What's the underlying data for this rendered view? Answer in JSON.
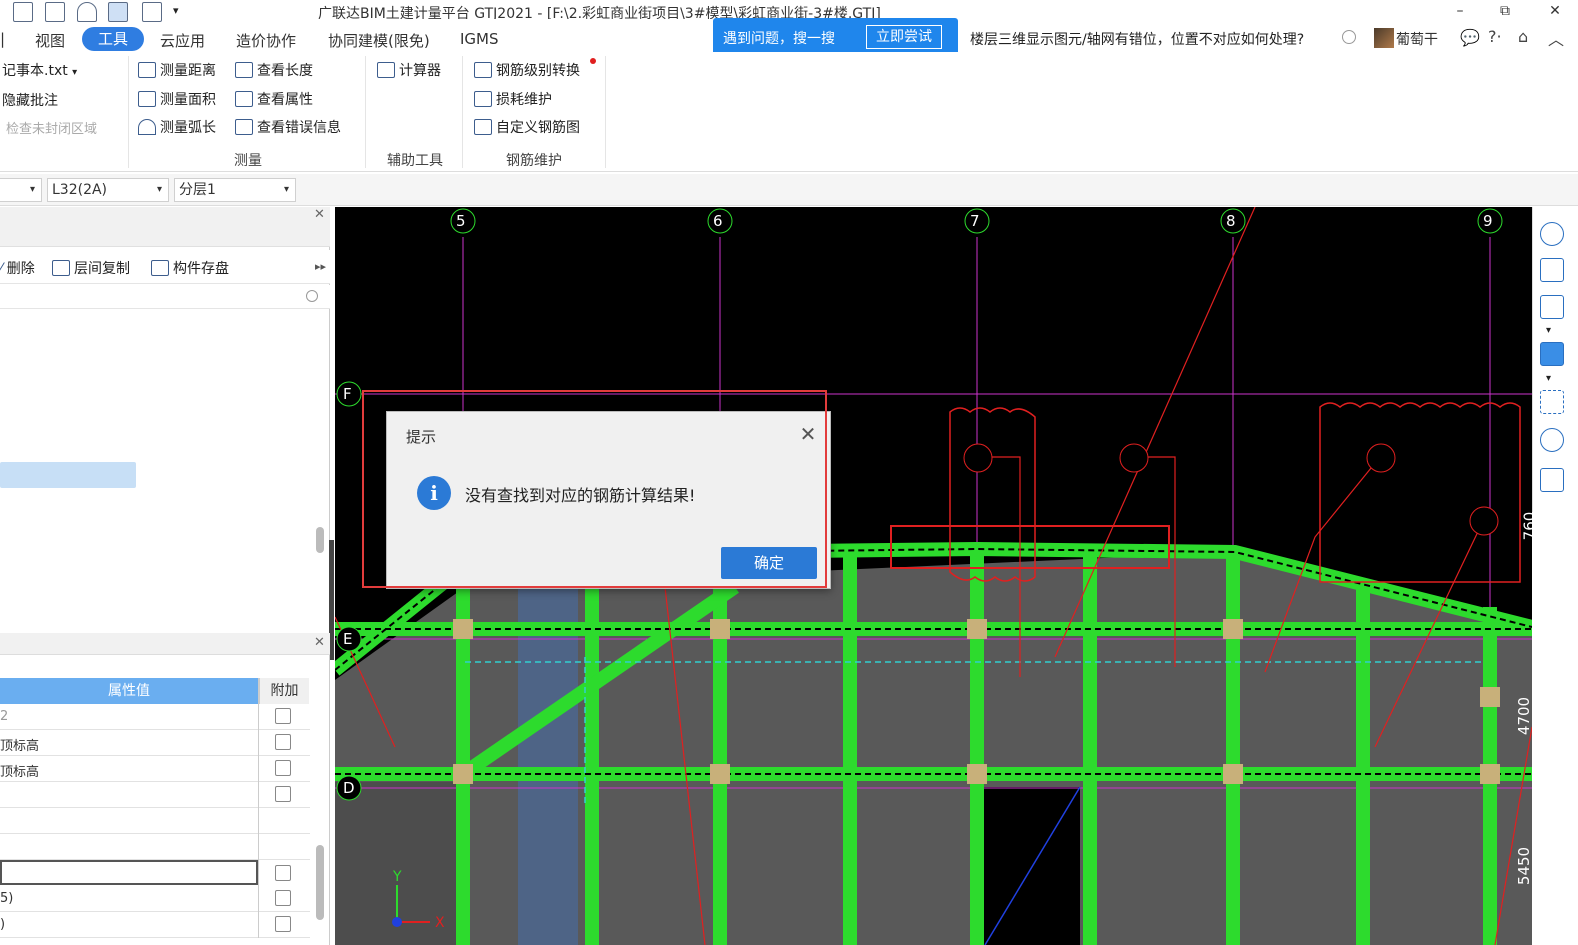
{
  "window": {
    "title": "广联达BIM土建计量平台 GTJ2021 - [F:\\2.彩虹商业街项目\\3#模型\\彩虹商业街-3#楼.GTJ]",
    "min": "–",
    "restore": "⧉",
    "close": "✕"
  },
  "menu": {
    "items": [
      "视图",
      "工具",
      "云应用",
      "造价协作",
      "协同建模(限免)",
      "IGMS"
    ],
    "active": "工具"
  },
  "banner": {
    "text": "遇到问题，搜一搜",
    "button": "立即尝试"
  },
  "search": {
    "question": "楼层三维显示图元/轴网有错位，位置不对应如何处理?"
  },
  "user": {
    "name": "葡萄干"
  },
  "ribbon": {
    "col1": [
      "记事本.txt",
      "隐藏批注",
      "检查未封闭区域"
    ],
    "measure": [
      "测量距离",
      "测量面积",
      "测量弧长"
    ],
    "view": [
      "查看长度",
      "查看属性",
      "查看错误信息"
    ],
    "aux": [
      "计算器"
    ],
    "rebar": [
      "钢筋级别转换",
      "损耗维护",
      "自定义钢筋图"
    ],
    "groups": [
      "测量",
      "辅助工具",
      "钢筋维护"
    ]
  },
  "combos": {
    "c2": "L32(2A)",
    "c3": "分层1"
  },
  "left_panel": {
    "toolbar": [
      "删除",
      "层间复制",
      "构件存盘"
    ]
  },
  "props": {
    "header_value": "属性值",
    "header_extra": "附加",
    "rows": [
      "2",
      "顶标高",
      "顶标高",
      "",
      "",
      "",
      "",
      "5)",
      ")"
    ]
  },
  "grid": {
    "columns": [
      "5",
      "6",
      "7",
      "8",
      "9"
    ],
    "rows": [
      "F",
      "E",
      "D"
    ],
    "dims": [
      "760",
      "4700",
      "5450"
    ]
  },
  "dialog": {
    "title": "提示",
    "message": "没有查找到对应的钢筋计算结果!",
    "ok": "确定",
    "close": "✕",
    "info_icon": "i"
  },
  "colors": {
    "accent": "#2b7ad6",
    "beam": "#2ddb2d",
    "axis": "#cc33cc",
    "highlight": "#e23c3c"
  }
}
